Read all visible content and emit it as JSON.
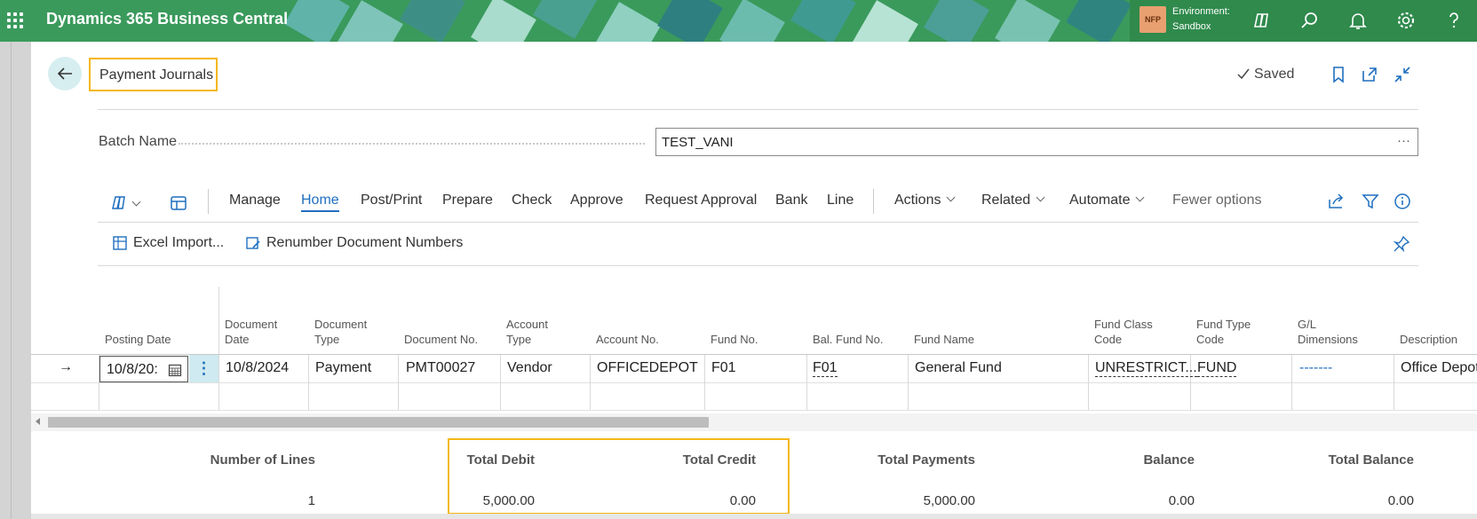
{
  "topbar": {
    "app_name": "Dynamics 365 Business Central",
    "env_badge": "NFP",
    "env_label": "Environment:",
    "env_name": "Sandbox",
    "icons": [
      "waffle-icon",
      "copilot-icon",
      "search-icon",
      "bell-icon",
      "gear-icon",
      "help-icon"
    ]
  },
  "header": {
    "title": "Payment Journals",
    "saved_label": "Saved"
  },
  "batch": {
    "label": "Batch Name",
    "value": "TEST_VANI",
    "lookup": "···"
  },
  "actions": {
    "manage": "Manage",
    "home": "Home",
    "post_print": "Post/Print",
    "prepare": "Prepare",
    "check": "Check",
    "approve": "Approve",
    "request_approval": "Request Approval",
    "bank": "Bank",
    "line": "Line",
    "actions": "Actions",
    "related": "Related",
    "automate": "Automate",
    "fewer_options": "Fewer options"
  },
  "subactions": {
    "excel_import": "Excel Import...",
    "renumber": "Renumber Document Numbers"
  },
  "columns": {
    "posting_date": "Posting Date",
    "document_date_1": "Document",
    "document_date_2": "Date",
    "document_type_1": "Document",
    "document_type_2": "Type",
    "document_no": "Document No.",
    "account_type_1": "Account",
    "account_type_2": "Type",
    "account_no": "Account No.",
    "fund_no": "Fund No.",
    "bal_fund_no": "Bal. Fund No.",
    "fund_name": "Fund Name",
    "fund_class_1": "Fund Class",
    "fund_class_2": "Code",
    "fund_type_1": "Fund Type",
    "fund_type_2": "Code",
    "gl_dim_1": "G/L",
    "gl_dim_2": "Dimensions",
    "description": "Description"
  },
  "row": {
    "marker": "→",
    "posting_date": "10/8/20:",
    "document_date": "10/8/2024",
    "document_type": "Payment",
    "document_no": "PMT00027",
    "account_type": "Vendor",
    "account_no": "OFFICEDEPOT",
    "fund_no": "F01",
    "bal_fund_no": "F01",
    "fund_name": "General Fund",
    "fund_class": "UNRESTRICT...",
    "fund_type": "FUND",
    "gl_dim": "-------",
    "description": "Office Depot"
  },
  "totals": {
    "lines_label": "Number of Lines",
    "lines_value": "1",
    "debit_label": "Total Debit",
    "debit_value": "5,000.00",
    "credit_label": "Total Credit",
    "credit_value": "0.00",
    "payments_label": "Total Payments",
    "payments_value": "5,000.00",
    "balance_label": "Balance",
    "balance_value": "0.00",
    "total_balance_label": "Total Balance",
    "total_balance_value": "0.00"
  },
  "colors": {
    "topbar": "#3a9a5c",
    "accent": "#1f6fbf",
    "highlight": "#f5b716",
    "selected_cell": "#cfeaf0"
  }
}
